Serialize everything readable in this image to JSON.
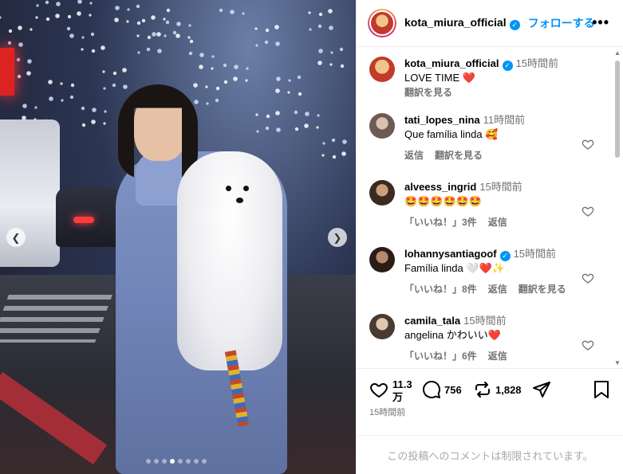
{
  "post": {
    "carousel": {
      "slide_count": 8,
      "active_index": 3
    }
  },
  "header": {
    "username": "kota_miura_official",
    "follow_label": "フォローする",
    "more_label": "•••"
  },
  "caption": {
    "username": "kota_miura_official",
    "time": "15時間前",
    "text": "LOVE TIME ❤️",
    "translate": "翻訳を見る"
  },
  "comments": [
    {
      "username": "tati_lopes_nina",
      "time": "11時間前",
      "text": "Que família linda 🥰",
      "actions": [
        "返信",
        "翻訳を見る"
      ],
      "verified": false
    },
    {
      "username": "alveess_ingrid",
      "time": "15時間前",
      "text": "🤩🤩🤩🤩🤩🤩",
      "actions": [
        "「いいね！」3件",
        "返信"
      ],
      "verified": false
    },
    {
      "username": "lohannysantiagoof",
      "time": "15時間前",
      "text": "Família linda 🤍❤️✨",
      "actions": [
        "「いいね！」8件",
        "返信",
        "翻訳を見る"
      ],
      "verified": true
    },
    {
      "username": "camila_tala",
      "time": "15時間前",
      "text": "angelina かわいい❤️",
      "actions": [
        "「いいね！」6件",
        "返信"
      ],
      "verified": false
    }
  ],
  "stats": {
    "likes": "11.3",
    "likes_unit": "万",
    "comments": "756",
    "reposts": "1,828",
    "posted": "15時間前"
  },
  "footer": {
    "restricted_text": "この投稿へのコメントは制限されています。"
  },
  "icons": {
    "like": "heart-icon",
    "comment": "comment-icon",
    "repost": "repost-icon",
    "share": "share-icon",
    "save": "bookmark-icon"
  }
}
